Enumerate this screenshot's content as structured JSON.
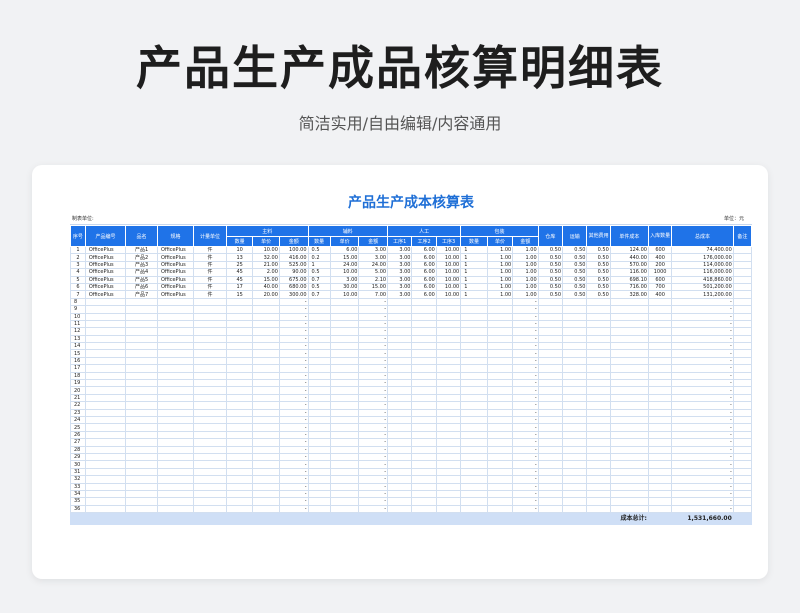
{
  "page": {
    "title": "产品生产成品核算明细表",
    "subtitle": "简洁实用/自由编辑/内容通用"
  },
  "sheet": {
    "title": "产品生产成本核算表",
    "maker_label": "制表单位:",
    "unit_label": "单位：元",
    "header_groups": {
      "index": "序号",
      "code": "产品编号",
      "name": "品名",
      "spec": "规格",
      "unit": "计量单位",
      "main_material": "主料",
      "aux_material": "辅料",
      "labor": "人工",
      "packaging": "包装",
      "warehouse": "仓库",
      "transport": "运输",
      "other": "其他费用",
      "unit_cost": "单件成本",
      "stock_qty": "入库数量",
      "total_cost": "总成本",
      "remark": "备注"
    },
    "sub_headers": {
      "qty": "数量",
      "price": "单价",
      "amount": "金额",
      "step1": "工序1",
      "step2": "工序2",
      "step3": "工序3"
    },
    "rows": [
      [
        "1",
        "OfficePlus",
        "产品1",
        "OfficePlus",
        "件",
        "10",
        "10.00",
        "100.00",
        "0.5",
        "6.00",
        "3.00",
        "3.00",
        "6.00",
        "10.00",
        "1",
        "1.00",
        "1.00",
        "0.50",
        "0.50",
        "0.50",
        "124.00",
        "600",
        "74,400.00",
        ""
      ],
      [
        "2",
        "OfficePlus",
        "产品2",
        "OfficePlus",
        "件",
        "13",
        "32.00",
        "416.00",
        "0.2",
        "15.00",
        "3.00",
        "3.00",
        "6.00",
        "10.00",
        "1",
        "1.00",
        "1.00",
        "0.50",
        "0.50",
        "0.50",
        "440.00",
        "400",
        "176,000.00",
        ""
      ],
      [
        "3",
        "OfficePlus",
        "产品3",
        "OfficePlus",
        "件",
        "25",
        "21.00",
        "525.00",
        "1",
        "24.00",
        "24.00",
        "3.00",
        "6.00",
        "10.00",
        "1",
        "1.00",
        "1.00",
        "0.50",
        "0.50",
        "0.50",
        "570.00",
        "200",
        "114,000.00",
        ""
      ],
      [
        "4",
        "OfficePlus",
        "产品4",
        "OfficePlus",
        "件",
        "45",
        "2.00",
        "90.00",
        "0.5",
        "10.00",
        "5.00",
        "3.00",
        "6.00",
        "10.00",
        "1",
        "1.00",
        "1.00",
        "0.50",
        "0.50",
        "0.50",
        "116.00",
        "1000",
        "116,000.00",
        ""
      ],
      [
        "5",
        "OfficePlus",
        "产品5",
        "OfficePlus",
        "件",
        "45",
        "15.00",
        "675.00",
        "0.7",
        "3.00",
        "2.10",
        "3.00",
        "6.00",
        "10.00",
        "1",
        "1.00",
        "1.00",
        "0.50",
        "0.50",
        "0.50",
        "698.10",
        "600",
        "418,860.00",
        ""
      ],
      [
        "6",
        "OfficePlus",
        "产品6",
        "OfficePlus",
        "件",
        "17",
        "40.00",
        "680.00",
        "0.5",
        "30.00",
        "15.00",
        "3.00",
        "6.00",
        "10.00",
        "1",
        "1.00",
        "1.00",
        "0.50",
        "0.50",
        "0.50",
        "716.00",
        "700",
        "501,200.00",
        ""
      ],
      [
        "7",
        "OfficePlus",
        "产品7",
        "OfficePlus",
        "件",
        "15",
        "20.00",
        "300.00",
        "0.7",
        "10.00",
        "7.00",
        "3.00",
        "6.00",
        "10.00",
        "1",
        "1.00",
        "1.00",
        "0.50",
        "0.50",
        "0.50",
        "328.00",
        "400",
        "131,200.00",
        ""
      ]
    ],
    "empty_row_first": 8,
    "empty_row_last": 36,
    "dash": "-",
    "total_label": "成本总计:",
    "total_value": "1,531,660.00"
  }
}
